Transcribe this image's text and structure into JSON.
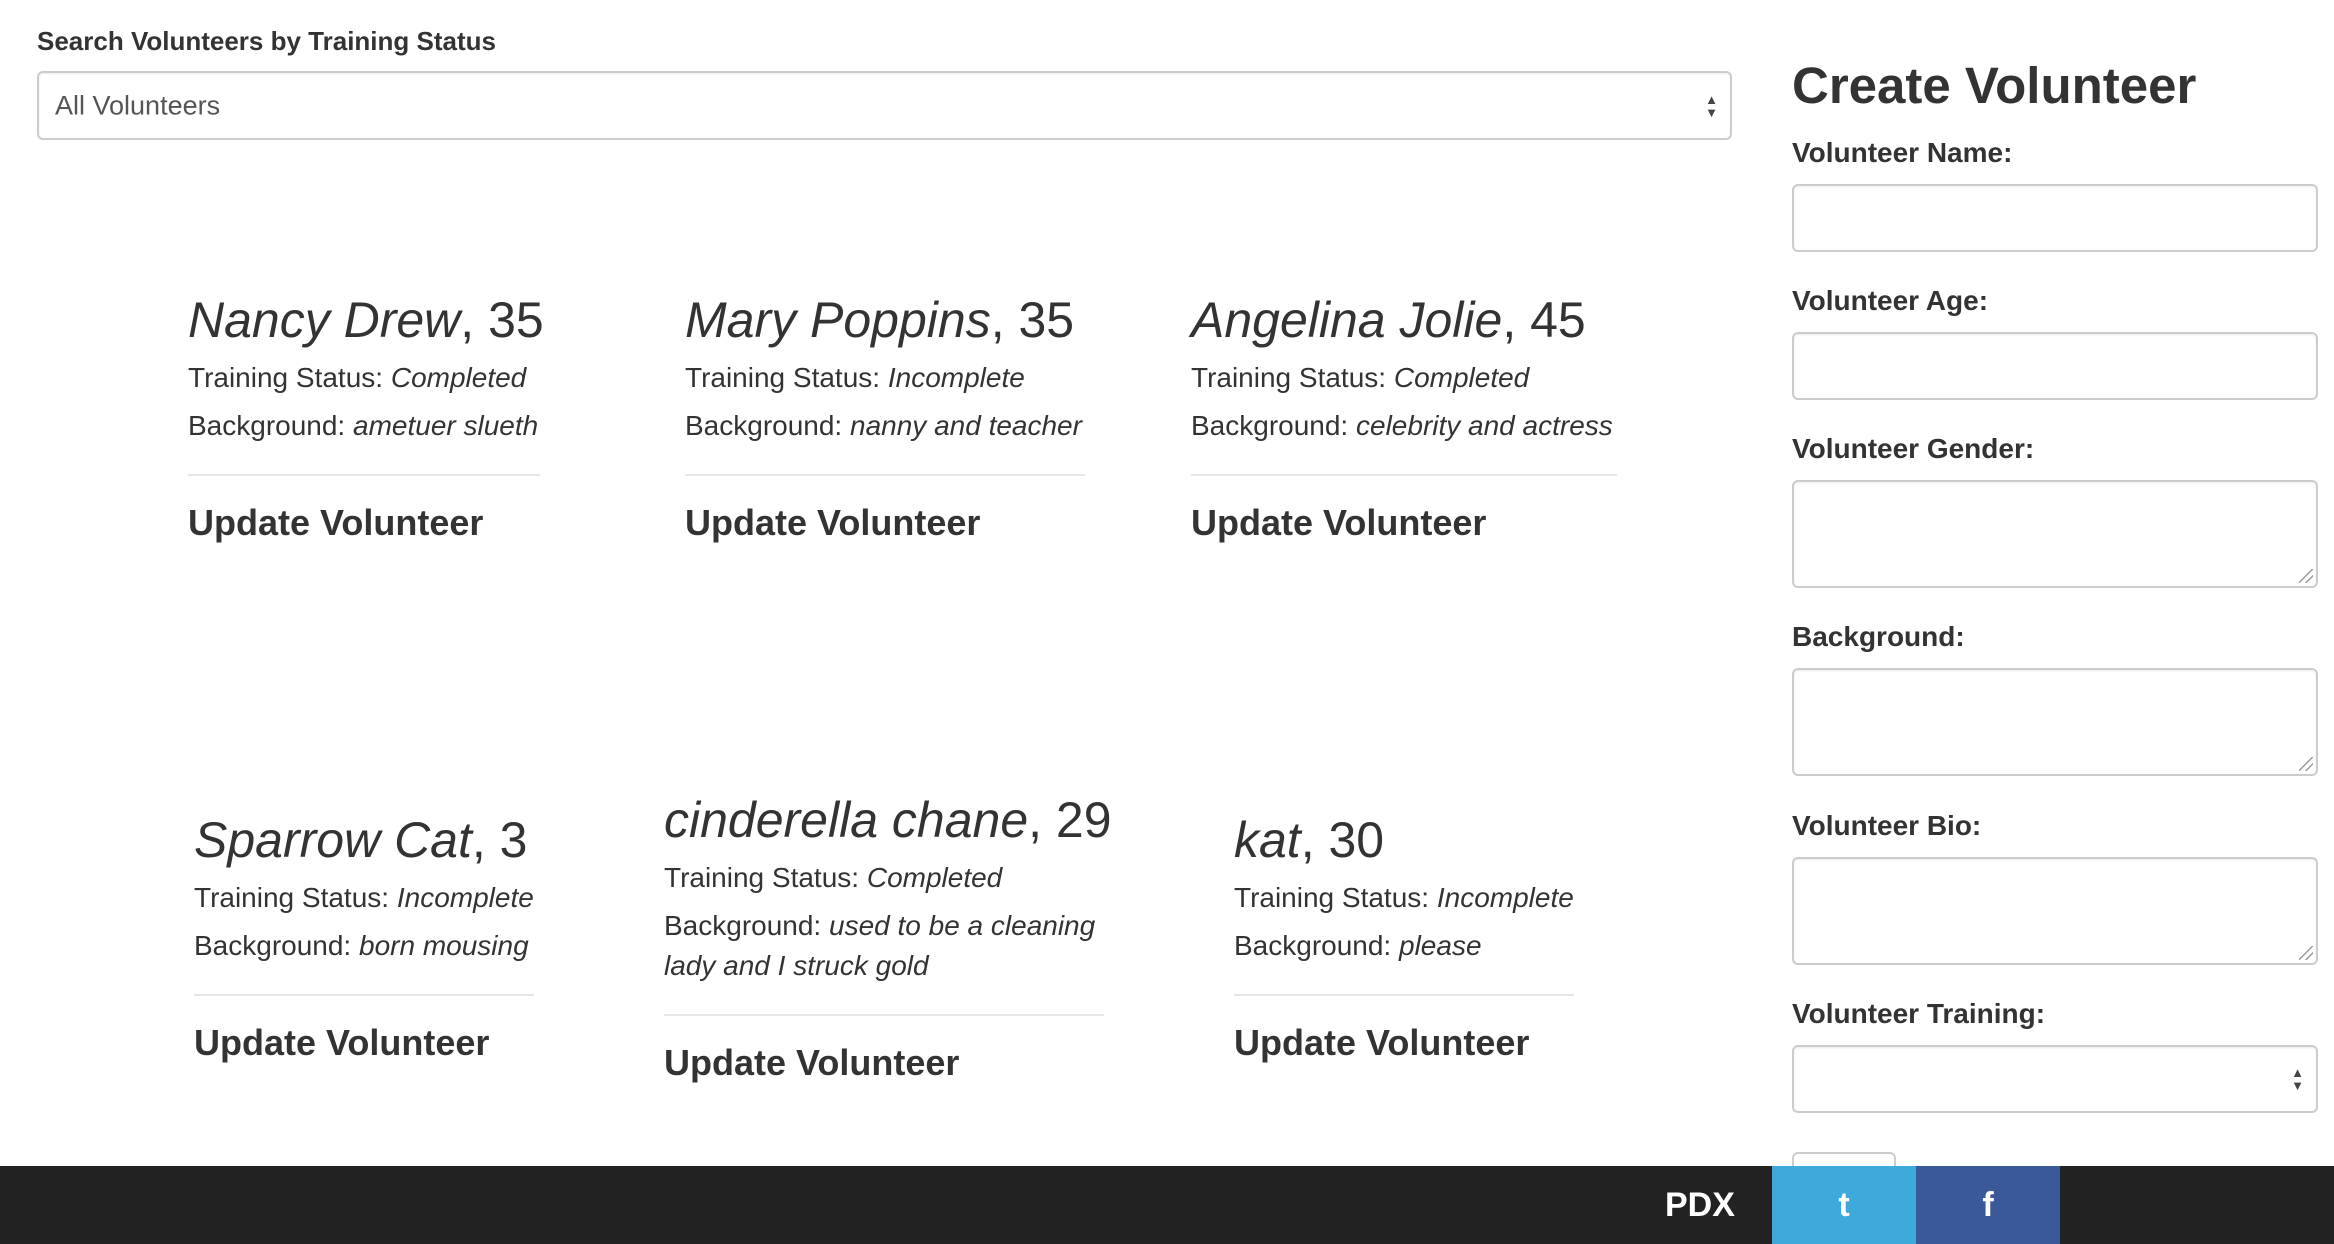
{
  "search": {
    "label": "Search Volunteers by Training Status",
    "selected": "All Volunteers"
  },
  "labels": {
    "training_status": "Training Status:",
    "background": "Background:",
    "update": "Update Volunteer"
  },
  "volunteers": [
    {
      "name": "Nancy Drew",
      "age": ", 35",
      "training": "Completed",
      "background": "ametuer slueth"
    },
    {
      "name": "Mary Poppins",
      "age": ", 35",
      "training": "Incomplete",
      "background": "nanny and teacher"
    },
    {
      "name": "Angelina Jolie",
      "age": ", 45",
      "training": "Completed",
      "background": "celebrity and actress"
    },
    {
      "name": "Sparrow Cat",
      "age": ", 3",
      "training": "Incomplete",
      "background": "born mousing"
    },
    {
      "name": "cinderella chane",
      "age": ", 29",
      "training": "Completed",
      "background": "used to be a cleaning lady and I struck gold"
    },
    {
      "name": "kat",
      "age": ", 30",
      "training": "Incomplete",
      "background": "please"
    }
  ],
  "create": {
    "title": "Create Volunteer",
    "name_label": "Volunteer Name:",
    "age_label": "Volunteer Age:",
    "gender_label": "Volunteer Gender:",
    "background_label": "Background:",
    "bio_label": "Volunteer Bio:",
    "training_label": "Volunteer Training:"
  },
  "footer": {
    "brand": "PDX",
    "twitter": "t",
    "facebook": "f",
    "twitter_color": "#3eaadc",
    "facebook_color": "#3b5998"
  }
}
